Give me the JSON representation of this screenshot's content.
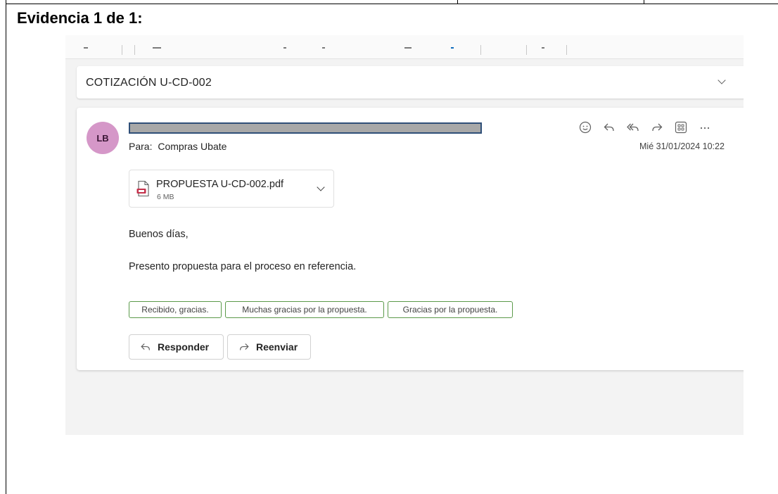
{
  "document": {
    "evidence_title": "Evidencia 1 de 1:"
  },
  "email": {
    "subject": "COTIZACIÓN U-CD-002",
    "sender_initials": "LB",
    "to_label": "Para:",
    "to_value": "Compras Ubate",
    "date": "Mié 31/01/2024 10:22",
    "attachment": {
      "name": "PROPUESTA U-CD-002.pdf",
      "size": "6 MB",
      "icon": "pdf-file-icon"
    },
    "greeting": "Buenos días,",
    "body": "Presento propuesta para el proceso en referencia.",
    "quick_replies": [
      "Recibido, gracias.",
      "Muchas gracias por la propuesta.",
      "Gracias por la propuesta."
    ],
    "reply_label": "Responder",
    "forward_label": "Reenviar",
    "actions": [
      "emoji-icon",
      "reply-icon",
      "reply-all-icon",
      "forward-icon",
      "apps-icon",
      "more-icon"
    ]
  },
  "colors": {
    "avatar_bg": "#d597c8",
    "quick_reply_border": "#5b9a4a",
    "redaction_border": "#2f4f78",
    "redaction_fill": "#a8a8a8",
    "pdf_red": "#c4314b"
  }
}
